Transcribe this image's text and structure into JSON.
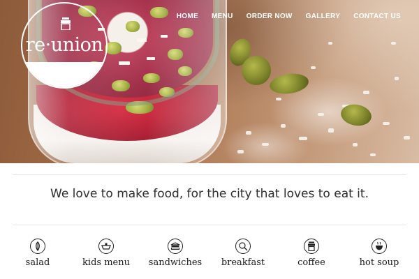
{
  "logo": {
    "text": "re·union"
  },
  "nav": {
    "items": [
      {
        "label": "HOME"
      },
      {
        "label": "MENU"
      },
      {
        "label": "ORDER NOW"
      },
      {
        "label": "GALLERY"
      },
      {
        "label": "CONTACT US"
      }
    ]
  },
  "tagline": "We love to make food, for the city that loves to eat it.",
  "categories": [
    {
      "label": "salad",
      "icon": "salad-icon"
    },
    {
      "label": "kids menu",
      "icon": "kids-menu-icon"
    },
    {
      "label": "sandwiches",
      "icon": "sandwich-icon"
    },
    {
      "label": "breakfast",
      "icon": "breakfast-icon"
    },
    {
      "label": "coffee",
      "icon": "coffee-icon"
    },
    {
      "label": "hot soup",
      "icon": "hot-soup-icon"
    }
  ]
}
